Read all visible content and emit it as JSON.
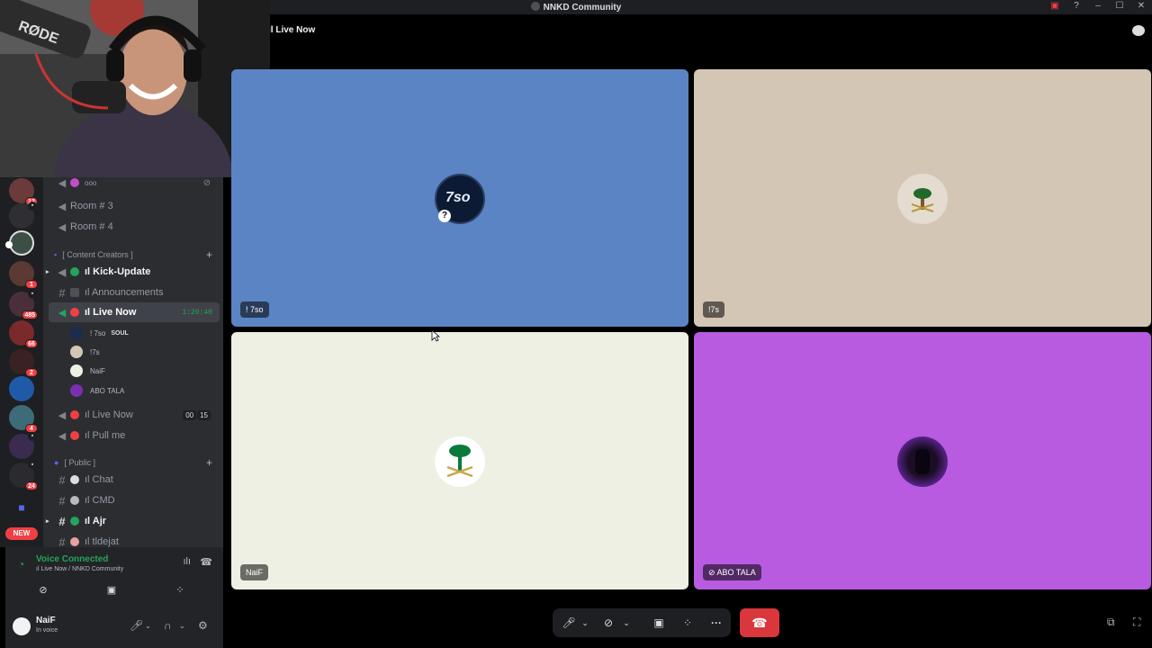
{
  "window": {
    "title": "NNKD Community"
  },
  "header": {
    "channel_title": "ıl Live Now"
  },
  "guild_badges": [
    "12",
    "1",
    "485",
    "66",
    "2",
    "4",
    "24"
  ],
  "new_badge": "NEW",
  "sidebar": {
    "channels": [
      {
        "label": "ooo",
        "kind": "voice-partial"
      },
      {
        "label": "Room # 3",
        "kind": "voice"
      },
      {
        "label": "Room # 4",
        "kind": "voice"
      },
      {
        "label": "[ Content Creators ]",
        "kind": "category"
      },
      {
        "label": "ıl Kick-Update",
        "kind": "text-bold"
      },
      {
        "label": "ıl Announcements",
        "kind": "text"
      },
      {
        "label": "ıl Live Now",
        "kind": "voice-selected",
        "time": "1:20:40"
      },
      {
        "label": "ıl Live Now",
        "kind": "voice",
        "count_a": "00",
        "count_b": "15"
      },
      {
        "label": "ıl Pull me",
        "kind": "voice"
      },
      {
        "label": "[ Public ]",
        "kind": "category"
      },
      {
        "label": "ıl Chat",
        "kind": "text"
      },
      {
        "label": "ıl CMD",
        "kind": "text"
      },
      {
        "label": "ıl Ajr",
        "kind": "text-bold"
      },
      {
        "label": "ıl tldejat",
        "kind": "text"
      }
    ],
    "voice_users": [
      {
        "name": "! 7so",
        "tag": "SOUL"
      },
      {
        "name": "!7s"
      },
      {
        "name": "NaiF"
      },
      {
        "name": "ABO TALA"
      }
    ]
  },
  "voice_panel": {
    "status": "Voice Connected",
    "location": "ıl Live Now / NNKD Community"
  },
  "user_panel": {
    "name": "NaiF",
    "status": "In voice"
  },
  "tiles": [
    {
      "label": "! 7so",
      "color": "#5b84c4"
    },
    {
      "label": "!7s",
      "color": "#d3c6b4"
    },
    {
      "label": "NaiF",
      "color": "#eef0e3"
    },
    {
      "label": "ABO TALA",
      "color": "#b85be0"
    }
  ],
  "colors": {
    "hangup": "#da373c",
    "connected": "#23a55a",
    "live_dot": "#f23f43"
  },
  "icons": [
    "mic-icon",
    "camera-off-icon",
    "screen-share-icon",
    "activity-icon",
    "more-icon",
    "hangup-icon",
    "popout-icon",
    "fullscreen-icon",
    "settings-icon",
    "headphones-icon"
  ]
}
